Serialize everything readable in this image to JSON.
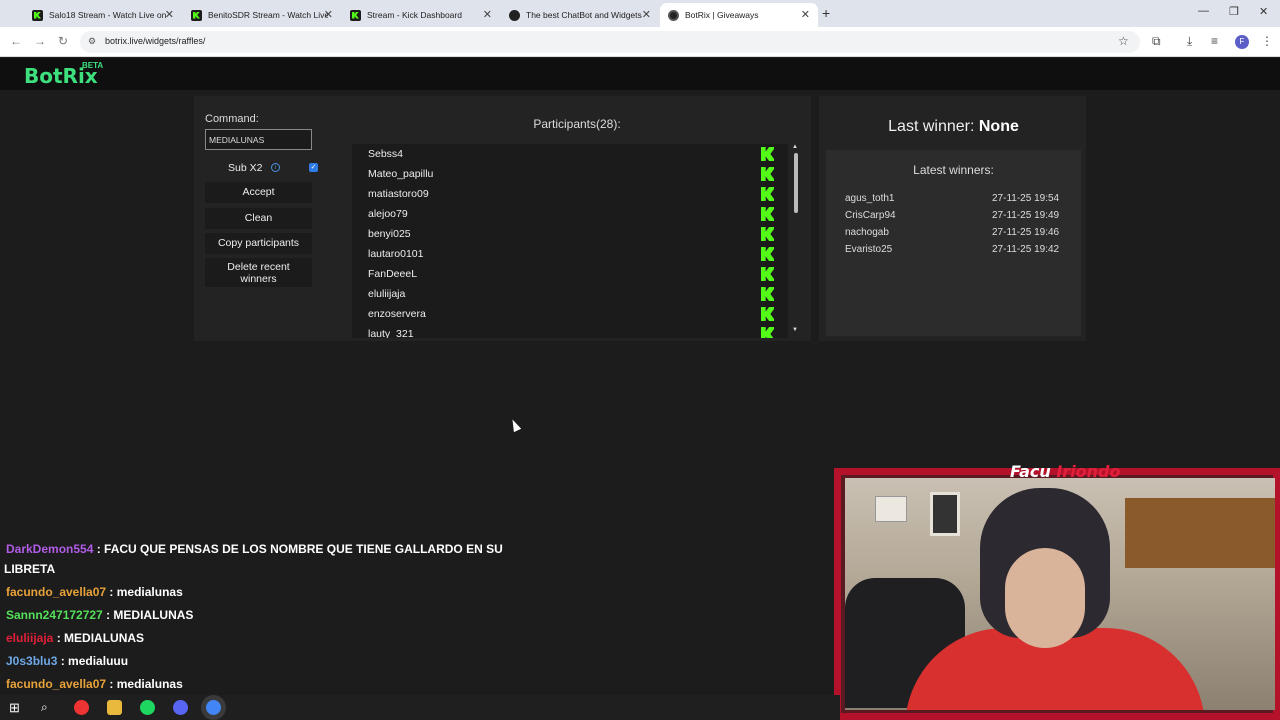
{
  "browser": {
    "tabs": [
      {
        "label": "Salo18 Stream - Watch Live on",
        "icon": "kick-icon"
      },
      {
        "label": "BenitoSDR Stream - Watch Live",
        "icon": "kick-icon"
      },
      {
        "label": "Stream - Kick Dashboard",
        "icon": "kick-icon"
      },
      {
        "label": "The best ChatBot and Widgets",
        "icon": "github-icon"
      },
      {
        "label": "BotRix | Giveaways",
        "icon": "botrix-icon"
      }
    ],
    "url": "botrix.live/widgets/raffles/",
    "profile_initial": "F"
  },
  "header": {
    "logo": "BotRix",
    "beta": "BETA"
  },
  "controls": {
    "command_label": "Command:",
    "command_value": "MEDIALUNAS",
    "sub_label": "Sub X2",
    "sub_checked": true,
    "accept": "Accept",
    "clean": "Clean",
    "copy": "Copy participants",
    "delete_recent": "Delete recent winners"
  },
  "participants": {
    "title": "Participants(28):",
    "list": [
      "Sebss4",
      "Mateo_papillu",
      "matiastoro09",
      "alejoo79",
      "benyi025",
      "lautaro0101",
      "FanDeeeL",
      "eluliijaja",
      "enzoservera",
      "lauty_321"
    ]
  },
  "winners": {
    "last_label": "Last winner:",
    "last_value": "None",
    "latest_title": "Latest winners:",
    "list": [
      {
        "name": "agus_toth1",
        "date": "27-11-25 19:54"
      },
      {
        "name": "CrisCarp94",
        "date": "27-11-25 19:49"
      },
      {
        "name": "nachogab",
        "date": "27-11-25 19:46"
      },
      {
        "name": "Evaristo25",
        "date": "27-11-25 19:42"
      }
    ]
  },
  "chat": [
    {
      "user": "DarkDemon554",
      "color": "#b05ce6",
      "text": ": FACU QUE PENSAS DE LOS NOMBRE QUE TIENE GALLARDO EN SU",
      "cont": "LIBRETA"
    },
    {
      "user": "facundo_avella07",
      "color": "#e8a23a",
      "text": ": medialunas"
    },
    {
      "user": "Sannn247172727",
      "color": "#54e05a",
      "text": ": MEDIALUNAS"
    },
    {
      "user": "eluliijaja",
      "color": "#e0203a",
      "text": ": MEDIALUNAS"
    },
    {
      "user": "J0s3blu3",
      "color": "#6fa8e8",
      "text": ": medialuuu"
    },
    {
      "user": "facundo_avella07",
      "color": "#e8a23a",
      "text": ": medialunas"
    }
  ],
  "webcam": {
    "name_first": "Facu",
    "name_last": "Iriondo"
  },
  "colors": {
    "accent": "#3ee07e",
    "kick": "#53fc18",
    "cam_frame": "#b4122a"
  }
}
